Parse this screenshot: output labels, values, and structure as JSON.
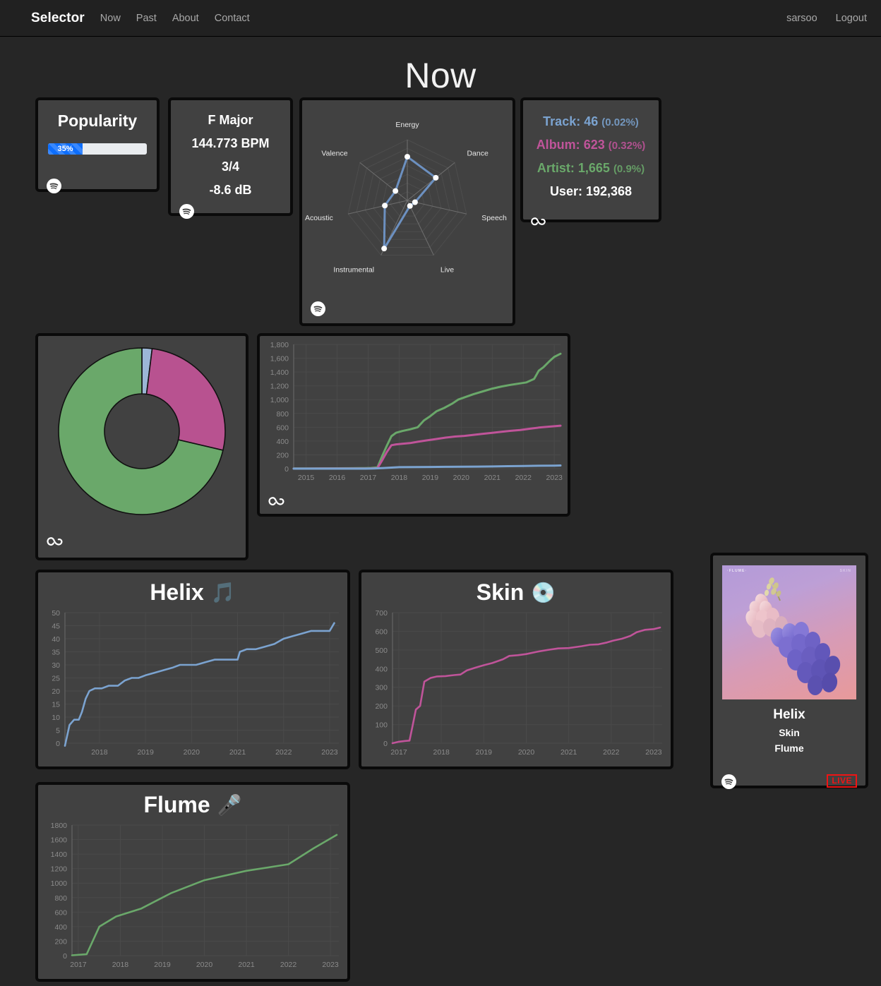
{
  "nav": {
    "brand": "Selector",
    "links": [
      {
        "label": "Now"
      },
      {
        "label": "Past"
      },
      {
        "label": "About"
      },
      {
        "label": "Contact"
      }
    ],
    "user": "sarsoo",
    "logout": "Logout"
  },
  "page": {
    "title": "Now"
  },
  "colors": {
    "track": "#7ba3d0",
    "album": "#c0549a",
    "artist": "#6aa86a",
    "accent_blue": "#0d6efd",
    "live_red": "#f01414",
    "card_bg": "#414141",
    "page_bg": "#262626",
    "border": "#0a0a0a"
  },
  "popularity": {
    "title": "Popularity",
    "percent_label": "35%",
    "percent": 35,
    "source_icon": "spotify-icon"
  },
  "features": {
    "key": "F Major",
    "tempo": "144.773 BPM",
    "time_signature": "3/4",
    "loudness": "-8.6 dB",
    "source_icon": "spotify-icon"
  },
  "stats": {
    "source_icon": "lastfm-icon",
    "rows": [
      {
        "label": "Track:",
        "value": "46",
        "pct": "(0.02%)",
        "color": "#7ba3d0"
      },
      {
        "label": "Album:",
        "value": "623",
        "pct": "(0.32%)",
        "color": "#c0549a"
      },
      {
        "label": "Artist:",
        "value": "1,665",
        "pct": "(0.9%)",
        "color": "#6aa86a"
      },
      {
        "label": "User:",
        "value": "192,368",
        "pct": "",
        "color": "#ffffff"
      }
    ]
  },
  "album_art": {
    "cover_top_left": "·FLUME·",
    "cover_top_right": "SKIN",
    "track": "Helix",
    "album": "Skin",
    "artist": "Flume",
    "live_badge": "LIVE",
    "source_icon": "spotify-icon"
  },
  "chart_data": [
    {
      "id": "radar",
      "type": "radar",
      "title": "",
      "source_icon": "spotify-icon",
      "categories": [
        "Energy",
        "Dance",
        "Speech",
        "Live",
        "Instrumental",
        "Acoustic",
        "Valence"
      ],
      "values": [
        0.72,
        0.6,
        0.13,
        0.1,
        0.88,
        0.38,
        0.25
      ],
      "ylim": [
        0,
        1
      ],
      "rings": 7,
      "line_color": "#6c90c0",
      "point_color": "#ffffff",
      "grid": true,
      "legend": "none"
    },
    {
      "id": "scrobble-donut",
      "type": "pie",
      "title": "",
      "source_icon": "lastfm-icon",
      "donut": true,
      "categories": [
        "Track",
        "Album",
        "Artist"
      ],
      "values": [
        46,
        623,
        1665
      ],
      "percents": [
        1.97,
        26.72,
        71.41
      ],
      "colors": [
        "#9cb6d6",
        "#b85290",
        "#6aa86a"
      ],
      "legend": "none"
    },
    {
      "id": "cumulative-scrobbles",
      "type": "line",
      "title": "",
      "source_icon": "lastfm-icon",
      "xlabel": "",
      "ylabel": "",
      "grid": true,
      "legend": "none",
      "ylim": [
        0,
        1800
      ],
      "yticks": [
        0,
        200,
        400,
        600,
        800,
        1000,
        1200,
        1400,
        1600,
        1800
      ],
      "ytick_labels": [
        "0",
        "200",
        "400",
        "600",
        "800",
        "1,000",
        "1,200",
        "1,400",
        "1,600",
        "1,800"
      ],
      "xticks": [
        "2015",
        "2016",
        "2017",
        "2018",
        "2019",
        "2020",
        "2021",
        "2022",
        "2023"
      ],
      "xlim": [
        2014.6,
        2023.2
      ],
      "series": [
        {
          "name": "Artist",
          "color": "#6aa86a",
          "x": [
            2014.6,
            2015.0,
            2015.5,
            2016.0,
            2016.5,
            2016.9,
            2017.1,
            2017.3,
            2017.45,
            2017.6,
            2017.75,
            2017.9,
            2018.1,
            2018.35,
            2018.6,
            2018.8,
            2019.0,
            2019.2,
            2019.45,
            2019.7,
            2019.9,
            2020.15,
            2020.4,
            2020.7,
            2021.0,
            2021.3,
            2021.6,
            2021.9,
            2022.1,
            2022.35,
            2022.5,
            2022.65,
            2022.85,
            2023.0,
            2023.2
          ],
          "y": [
            2,
            3,
            4,
            5,
            6,
            8,
            10,
            18,
            180,
            330,
            470,
            520,
            545,
            570,
            600,
            700,
            760,
            830,
            880,
            940,
            1000,
            1040,
            1080,
            1120,
            1160,
            1190,
            1215,
            1235,
            1250,
            1300,
            1420,
            1470,
            1560,
            1620,
            1665
          ]
        },
        {
          "name": "Album",
          "color": "#c0549a",
          "x": [
            2014.6,
            2015.0,
            2015.5,
            2016.0,
            2016.5,
            2016.9,
            2017.1,
            2017.3,
            2017.45,
            2017.6,
            2017.75,
            2017.9,
            2018.1,
            2018.35,
            2018.6,
            2018.9,
            2019.2,
            2019.5,
            2019.8,
            2020.1,
            2020.4,
            2020.7,
            2021.0,
            2021.3,
            2021.6,
            2021.9,
            2022.2,
            2022.5,
            2022.8,
            2023.0,
            2023.2
          ],
          "y": [
            1,
            1,
            2,
            2,
            3,
            3,
            4,
            8,
            120,
            240,
            340,
            352,
            360,
            370,
            390,
            410,
            430,
            450,
            465,
            475,
            490,
            505,
            520,
            535,
            548,
            560,
            578,
            595,
            608,
            615,
            623
          ]
        },
        {
          "name": "Track",
          "color": "#7ba3d0",
          "x": [
            2014.6,
            2016.9,
            2017.2,
            2017.5,
            2018.0,
            2018.5,
            2019.0,
            2019.5,
            2020.0,
            2020.5,
            2021.0,
            2021.5,
            2022.0,
            2022.5,
            2023.0,
            2023.2
          ],
          "y": [
            0,
            0,
            2,
            9,
            21,
            23,
            25,
            27,
            29,
            30,
            32,
            36,
            39,
            42,
            44,
            46
          ]
        }
      ]
    },
    {
      "id": "track-scrobbles",
      "type": "line",
      "title": "Helix",
      "title_emoji": "🎵",
      "xlabel": "",
      "ylabel": "",
      "grid": true,
      "legend": "none",
      "ylim": [
        0,
        50
      ],
      "yticks": [
        0,
        5,
        10,
        15,
        20,
        25,
        30,
        35,
        40,
        45,
        50
      ],
      "xticks": [
        "2018",
        "2019",
        "2020",
        "2021",
        "2022",
        "2023"
      ],
      "xlim": [
        2017.25,
        2023.2
      ],
      "series": [
        {
          "name": "Helix",
          "color": "#7ba3d0",
          "x": [
            2017.25,
            2017.35,
            2017.45,
            2017.55,
            2017.62,
            2017.7,
            2017.78,
            2017.9,
            2018.05,
            2018.2,
            2018.4,
            2018.55,
            2018.7,
            2018.85,
            2019.0,
            2019.2,
            2019.4,
            2019.6,
            2019.75,
            2019.9,
            2020.1,
            2020.3,
            2020.5,
            2020.75,
            2021.0,
            2021.05,
            2021.2,
            2021.4,
            2021.6,
            2021.8,
            2022.0,
            2022.2,
            2022.4,
            2022.6,
            2022.8,
            2023.0,
            2023.1
          ],
          "y": [
            -1,
            7,
            9,
            9,
            12,
            17,
            20,
            21,
            21,
            22,
            22,
            24,
            25,
            25,
            26,
            27,
            28,
            29,
            30,
            30,
            30,
            31,
            32,
            32,
            32,
            35,
            36,
            36,
            37,
            38,
            40,
            41,
            42,
            43,
            43,
            43,
            46
          ]
        }
      ]
    },
    {
      "id": "album-scrobbles",
      "type": "line",
      "title": "Skin",
      "title_emoji": "💿",
      "xlabel": "",
      "ylabel": "",
      "grid": true,
      "legend": "none",
      "ylim": [
        0,
        700
      ],
      "yticks": [
        0,
        100,
        200,
        300,
        400,
        500,
        600,
        700
      ],
      "xticks": [
        "2017",
        "2018",
        "2019",
        "2020",
        "2021",
        "2022",
        "2023"
      ],
      "xlim": [
        2016.85,
        2023.2
      ],
      "series": [
        {
          "name": "Skin",
          "color": "#c0549a",
          "x": [
            2016.85,
            2017.0,
            2017.15,
            2017.25,
            2017.32,
            2017.4,
            2017.5,
            2017.6,
            2017.75,
            2017.9,
            2018.1,
            2018.3,
            2018.45,
            2018.6,
            2018.8,
            2019.0,
            2019.2,
            2019.45,
            2019.6,
            2019.8,
            2020.0,
            2020.25,
            2020.5,
            2020.75,
            2021.0,
            2021.3,
            2021.5,
            2021.7,
            2021.9,
            2022.05,
            2022.25,
            2022.45,
            2022.6,
            2022.8,
            2023.0,
            2023.15
          ],
          "y": [
            0,
            8,
            12,
            14,
            90,
            180,
            200,
            330,
            350,
            358,
            360,
            365,
            368,
            390,
            405,
            418,
            430,
            450,
            468,
            472,
            478,
            490,
            500,
            508,
            510,
            520,
            528,
            530,
            540,
            550,
            560,
            575,
            595,
            608,
            612,
            620
          ]
        }
      ]
    },
    {
      "id": "artist-scrobbles",
      "type": "line",
      "title": "Flume",
      "title_emoji": "🎤",
      "xlabel": "",
      "ylabel": "",
      "grid": true,
      "legend": "none",
      "ylim": [
        0,
        1800
      ],
      "yticks": [
        0,
        200,
        400,
        600,
        800,
        1000,
        1200,
        1400,
        1600,
        1800
      ],
      "xticks": [
        "2017",
        "2018",
        "2019",
        "2020",
        "2021",
        "2022",
        "2023"
      ],
      "xlim": [
        2016.85,
        2023.2
      ],
      "series": [
        {
          "name": "Flume",
          "color": "#6aa86a",
          "x": [
            2016.85,
            2017.2,
            2017.5,
            2017.9,
            2018.5,
            2019.2,
            2020.0,
            2021.0,
            2022.0,
            2022.6,
            2023.15
          ],
          "y": [
            5,
            20,
            400,
            540,
            650,
            860,
            1040,
            1170,
            1260,
            1480,
            1665
          ]
        }
      ]
    }
  ]
}
